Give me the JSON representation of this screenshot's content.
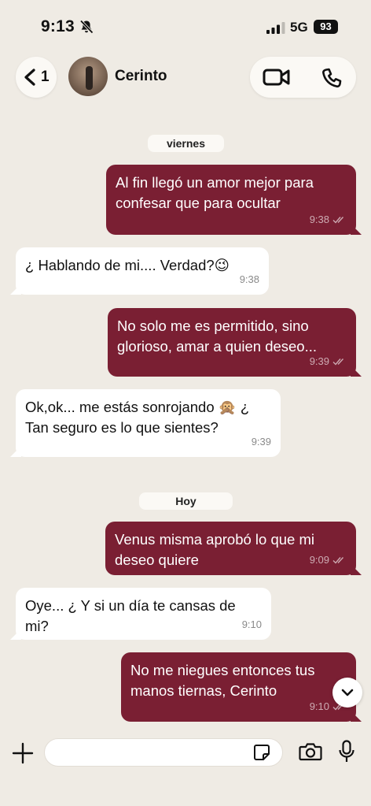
{
  "status_bar": {
    "time": "9:13",
    "network": "5G",
    "battery": "93"
  },
  "header": {
    "back_count": "1",
    "contact_name": "Cerinto"
  },
  "messages": [
    {
      "type": "date",
      "text": "viernes"
    },
    {
      "type": "out",
      "text": "Al fin llegó un amor mejor para confesar que para ocultar",
      "time": "9:38"
    },
    {
      "type": "in",
      "text": "¿ Hablando de mi.... Verdad?😉",
      "time": "9:38"
    },
    {
      "type": "out",
      "text": "No solo me es permitido, sino glorioso, amar a quien deseo...",
      "time": "9:39"
    },
    {
      "type": "in",
      "text": "Ok,ok... me estás sonrojando 🙊 ¿ Tan seguro es lo que sientes?",
      "time": "9:39"
    },
    {
      "type": "date",
      "text": "Hoy"
    },
    {
      "type": "out",
      "text": "Venus misma aprobó lo que mi deseo quiere",
      "time": "9:09"
    },
    {
      "type": "in",
      "text": "Oye... ¿ Y si un día te cansas de mi?",
      "time": "9:10"
    },
    {
      "type": "out",
      "text": "No me niegues entonces tus manos tiernas, Cerinto",
      "time": "9:10"
    }
  ],
  "colors": {
    "background": "#efebe4",
    "outgoing_bubble": "#7a1f33",
    "incoming_bubble": "#ffffff"
  },
  "icons": {
    "back": "chevron-left-icon",
    "video": "video-camera-icon",
    "call": "phone-icon",
    "silent": "bell-slash-icon",
    "attach": "plus-icon",
    "sticker": "sticker-icon",
    "camera": "camera-icon",
    "mic": "microphone-icon",
    "scroll": "chevron-down-icon",
    "read": "double-check-icon"
  }
}
